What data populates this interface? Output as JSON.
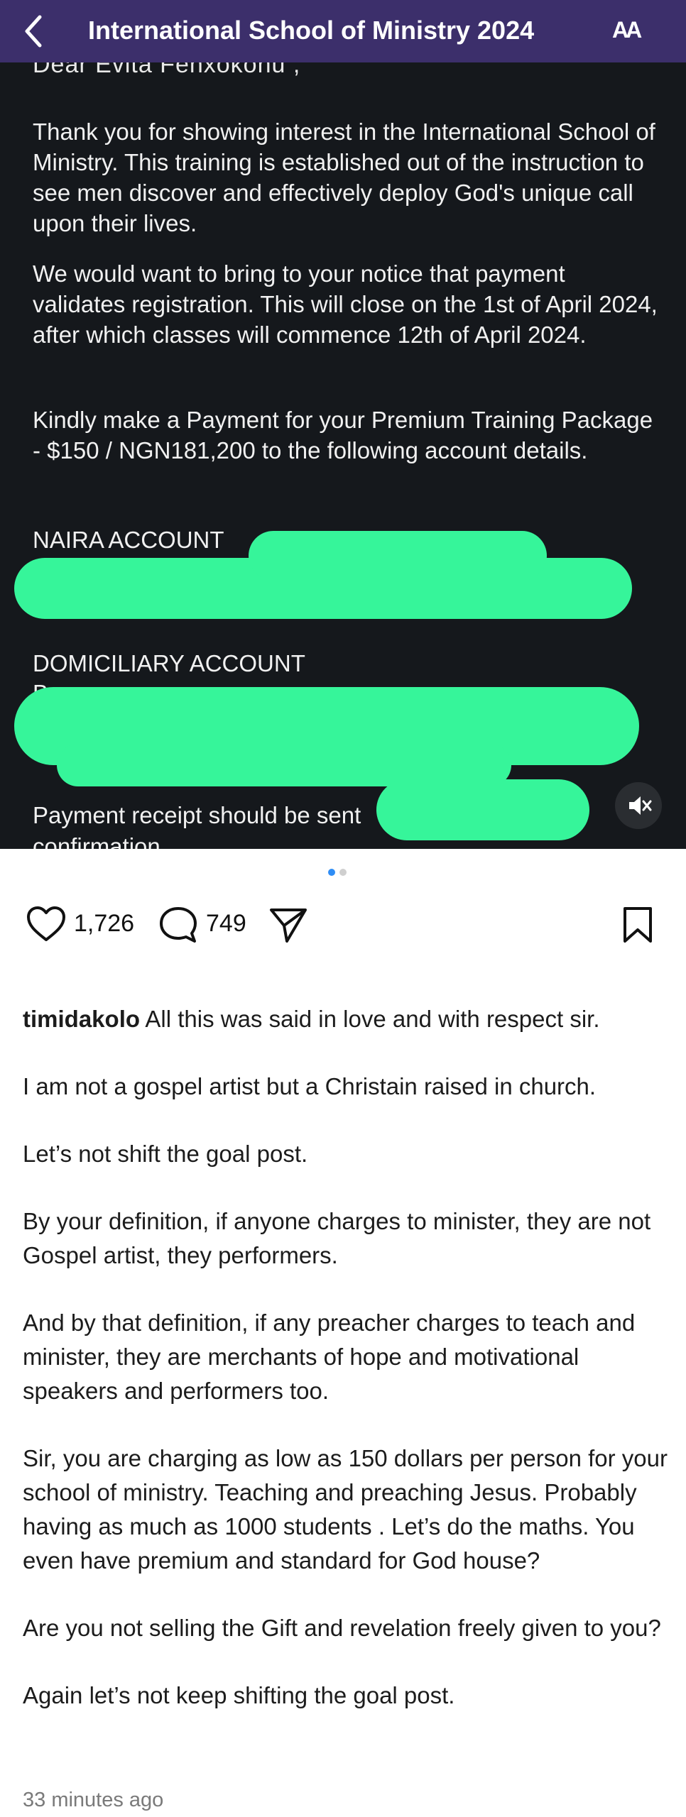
{
  "header": {
    "title": "International School of Ministry 2024",
    "text_size_label": "AA"
  },
  "letter": {
    "salutation_cut": "Dear Evita Fenxokonu ,",
    "paragraph1": "Thank you for showing interest in the International School of Ministry. This training is established out of the instruction to see men discover and effectively deploy God's unique call upon their lives.",
    "paragraph2": "We would want to bring to your notice that payment validates registration. This will close on the 1st of April 2024, after which classes will commence 12th of April 2024.",
    "paragraph3": "Kindly make a Payment for your Premium Training Package - $150 / NGN181,200 to the following account details.",
    "naira_account_label": "NAIRA ACCOUNT",
    "domiciliary_account_label": "DOMICILIARY ACCOUNT",
    "domiciliary_partial": "B",
    "receipt_line": "Payment receipt should be sent",
    "confirmation_partial": "confirmation",
    "redaction_color": "#36f59a",
    "background_color": "#15181c"
  },
  "carousel": {
    "active_index": 1,
    "total": 2,
    "active_color": "#2f8df5"
  },
  "actions": {
    "likes": "1,726",
    "comments": "749"
  },
  "caption": {
    "username": "timidakolo",
    "first_line": " All this  was said in love and with respect sir.",
    "paragraphs": [
      "I am not a gospel artist but a Christain raised in church.",
      "Let’s not shift the goal post.",
      "By your definition, if anyone charges to minister, they are not Gospel artist, they performers.",
      "And by that definition, if any preacher charges to teach and minister, they are merchants of hope and motivational speakers and performers too.",
      "Sir, you are charging as low as 150 dollars per person for your school of ministry. Teaching and preaching Jesus.  Probably having as much as 1000 students . Let’s do the maths. You even have premium and standard for God house?",
      "Are you not selling the Gift and revelation freely given to you?",
      "Again let’s not keep shifting the goal post."
    ],
    "timestamp": "33 minutes ago"
  },
  "colors": {
    "header_bg": "#3c2f6b",
    "accent": "#2f8df5"
  },
  "icons": [
    "back-chevron-icon",
    "text-size-icon",
    "muted-speaker-icon",
    "heart-icon",
    "comment-icon",
    "share-icon",
    "bookmark-icon"
  ]
}
